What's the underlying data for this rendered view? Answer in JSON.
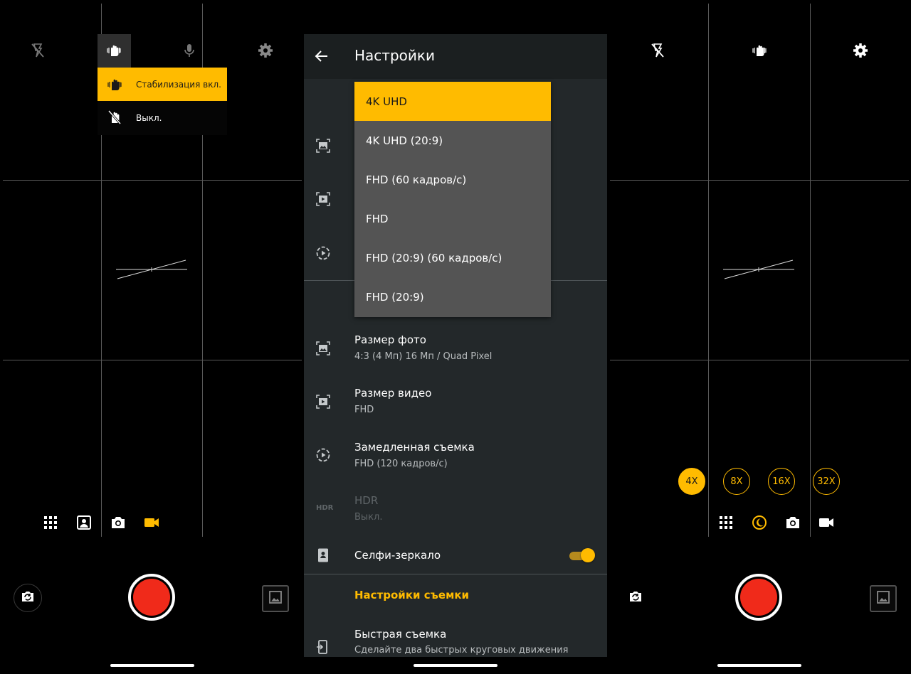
{
  "left_screen": {
    "stabilization_menu": {
      "on_label": "Стабилизация вкл.",
      "off_label": "Выкл."
    },
    "top_icons": [
      "flash-off-icon",
      "stabilization-icon",
      "microphone-icon",
      "gear-icon"
    ],
    "mode_icons": [
      "grid-apps-icon",
      "portrait-icon",
      "camera-icon",
      "video-icon"
    ]
  },
  "settings": {
    "title": "Настройки",
    "resolution_dropdown": {
      "options": [
        "4K UHD",
        "4K UHD (20:9)",
        "FHD (60 кадров/с)",
        "FHD",
        "FHD (20:9) (60 кадров/с)",
        "FHD (20:9)"
      ],
      "selected": "4K UHD"
    },
    "rows": [
      {
        "title": "Размер фото",
        "subtitle": "4:3 (4 Мп) 16 Мп / Quad Pixel"
      },
      {
        "title": "Размер видео",
        "subtitle": "FHD"
      },
      {
        "title": "Замедленная съемка",
        "subtitle": "FHD (120 кадров/с)"
      },
      {
        "title": "HDR",
        "subtitle": "Выкл."
      },
      {
        "title": "Селфи-зеркало",
        "subtitle": ""
      }
    ],
    "hdr_icon_text": "HDR",
    "selfie_mirror_enabled": true,
    "section_label": "Настройки съемки",
    "quick_capture": {
      "title": "Быстрая съемка",
      "subtitle": "Сделайте два быстрых круговых движения"
    }
  },
  "right_screen": {
    "zoom_levels": [
      "4X",
      "8X",
      "16X",
      "32X"
    ],
    "active_zoom": "4X",
    "top_icons": [
      "flash-off-icon",
      "stabilization-icon",
      "gear-icon"
    ],
    "mode_icons": [
      "grid-apps-icon",
      "night-mode-icon",
      "camera-icon",
      "video-icon"
    ]
  },
  "colors": {
    "accent": "#ffbb00",
    "shutter_red": "#f02a1a",
    "panel_bg": "#23282a"
  }
}
